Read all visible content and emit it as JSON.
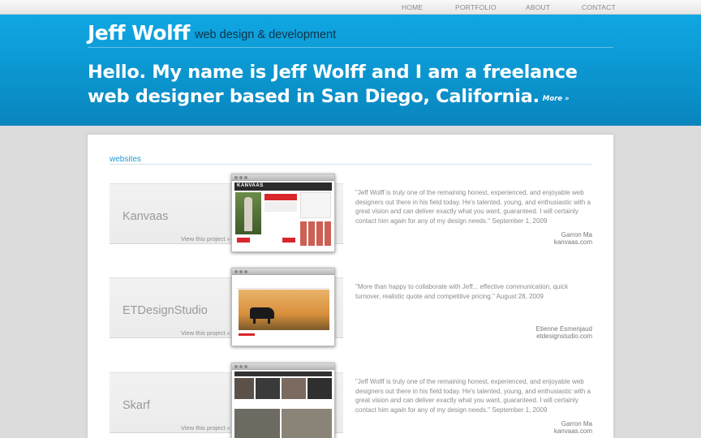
{
  "nav": [
    "HOME",
    "PORTFOLIO",
    "ABOUT",
    "CONTACT"
  ],
  "brand": {
    "name": "Jeff Wolff",
    "tagline": "web design & development"
  },
  "intro": {
    "line1": "Hello. My name is Jeff Wolff and I am a freelance",
    "line2": "web designer based in San Diego, California.",
    "more": "More »"
  },
  "section_title": "websites",
  "projects": [
    {
      "name": "Kanvaas",
      "link": "View this project »",
      "quote": "\"Jeff Wolff is truly one of the remaining honest, experienced, and enjoyable web designers out there in his field today. He's talented, young, and enthusiastic with a great vision and can deliver exactly what you want, guaranteed. I will certainly contact him again for any of my design needs.\" September 1, 2009",
      "author": "Garron Ma",
      "site": "kanvaas.com",
      "thumb_logo": "KANVAAS"
    },
    {
      "name": "ETDesignStudio",
      "link": "View this project »",
      "quote": "\"More than happy to collaborate with Jeff... effective communication, quick turnover, realistic quote and competitive pricing.\" August 28, 2009",
      "author": "Etienne Esmenjaud",
      "site": "etdesignstudio.com"
    },
    {
      "name": "Skarf",
      "link": "View this project »",
      "quote": "\"Jeff Wolff is truly one of the remaining honest, experienced, and enjoyable web designers out there in his field today. He's talented, young, and enthusiastic with a great vision and can deliver exactly what you want, guaranteed. I will certainly contact him again for any of my design needs.\" September 1, 2009",
      "author": "Garron Ma",
      "site": "kanvaas.com"
    }
  ],
  "colors": {
    "header_blue": "#0a9ad6",
    "link_blue": "#1f9ad2",
    "page_bg": "#dcdcdc"
  }
}
